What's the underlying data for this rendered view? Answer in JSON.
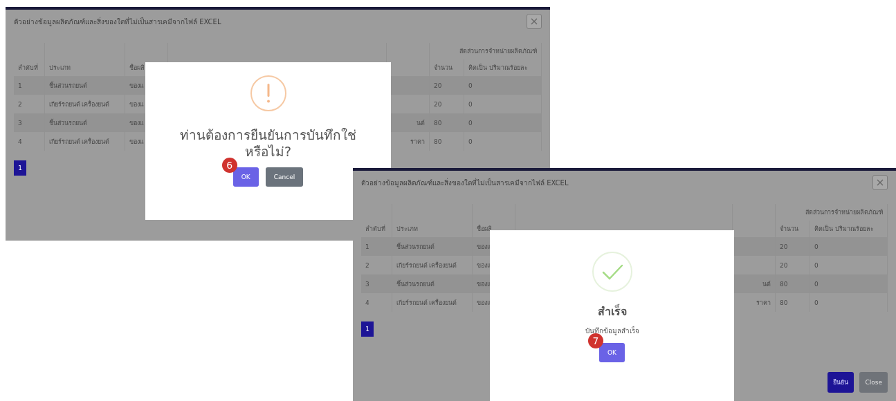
{
  "screens": [
    {
      "step": "6",
      "title": "ตัวอย่างข้อมูลผลิตภัณฑ์และสิ่งของใดที่ไม่เป็นสารเคมีจากไฟล์ EXCEL",
      "table": {
        "group_header": "สัดส่วนการจำหน่ายผลิตภัณฑ์",
        "columns": [
          "ลำดับที่",
          "ประเภท",
          "ชื่อผลิ",
          "จำนวน",
          "คิดเป็น ปริมาณร้อยละ"
        ],
        "rows": [
          {
            "no": "1",
            "type": "ชิ้นส่วนรถยนต์",
            "name": "ของแ",
            "tail": "",
            "qty": "20",
            "pct": "0"
          },
          {
            "no": "2",
            "type": "เกียร์รถยนต์ เครื่องยนต์",
            "name": "ของแ",
            "tail": "",
            "qty": "20",
            "pct": "0"
          },
          {
            "no": "3",
            "type": "ชิ้นส่วนรถยนต์",
            "name": "ของแ",
            "tail": "นต์",
            "qty": "80",
            "pct": "0"
          },
          {
            "no": "4",
            "type": "เกียร์รถยนต์ เครื่องยนต์",
            "name": "ของแ",
            "tail": "ราคา",
            "qty": "80",
            "pct": "0"
          }
        ]
      },
      "pages": [
        {
          "label": "1",
          "selected": true
        }
      ],
      "dialog": {
        "kind": "confirm",
        "title": "ท่านต้องการยืนยันการบันทึกใช่หรือไม่?",
        "buttons": [
          {
            "label": "OK",
            "kind": "primary"
          },
          {
            "label": "Cancel",
            "kind": "secondary"
          }
        ]
      }
    },
    {
      "step": "7",
      "title": "ตัวอย่างข้อมูลผลิตภัณฑ์และสิ่งของใดที่ไม่เป็นสารเคมีจากไฟล์ EXCEL",
      "table": {
        "group_header": "สัดส่วนการจำหน่ายผลิตภัณฑ์",
        "columns": [
          "ลำดับที่",
          "ประเภท",
          "ชื่อผลิ",
          "จำนวน",
          "คิดเป็น ปริมาณร้อยละ"
        ],
        "rows": [
          {
            "no": "1",
            "type": "ชิ้นส่วนรถยนต์",
            "name": "ของแ",
            "tail": "",
            "qty": "20",
            "pct": "0"
          },
          {
            "no": "2",
            "type": "เกียร์รถยนต์ เครื่องยนต์",
            "name": "ของแ",
            "tail": "",
            "qty": "20",
            "pct": "0"
          },
          {
            "no": "3",
            "type": "ชิ้นส่วนรถยนต์",
            "name": "ของแ",
            "tail": "นต์",
            "qty": "80",
            "pct": "0"
          },
          {
            "no": "4",
            "type": "เกียร์รถยนต์ เครื่องยนต์",
            "name": "ของแ",
            "tail": "ราคา",
            "qty": "80",
            "pct": "0"
          }
        ]
      },
      "pages": [
        {
          "label": "1",
          "selected": true
        }
      ],
      "footer_buttons": [
        {
          "label": "ยืนยัน",
          "kind": "primary"
        },
        {
          "label": "Close",
          "kind": "secondary"
        }
      ],
      "dialog": {
        "kind": "success",
        "title": "สำเร็จ",
        "message": "บันทึกข้อมูลสำเร็จ",
        "buttons": [
          {
            "label": "OK",
            "kind": "primary"
          }
        ]
      }
    }
  ]
}
